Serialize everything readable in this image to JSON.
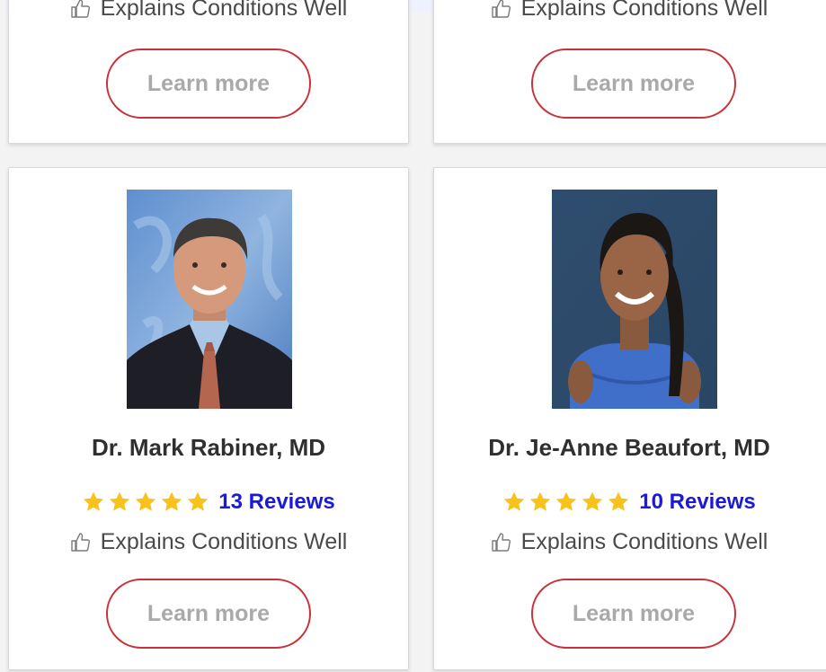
{
  "colors": {
    "star": "#f7c21b",
    "review_link": "#1a1ad8",
    "button_border": "#c8323a",
    "button_text": "#a9a9a9",
    "card_bg": "#ffffff",
    "page_bg": "#f3f3f3",
    "dark_strip": "#444444",
    "blue_strip": "#eef1ff"
  },
  "cards_top": [
    {
      "tagline": "Explains Conditions Well",
      "button": "Learn more"
    },
    {
      "tagline": "Explains Conditions Well",
      "button": "Learn more"
    }
  ],
  "cards": [
    {
      "name": "Dr. Mark Rabiner, MD",
      "rating": 5,
      "reviews": "13 Reviews",
      "tagline": "Explains Conditions Well",
      "button": "Learn more"
    },
    {
      "name": "Dr. Je-Anne Beaufort, MD",
      "rating": 5,
      "reviews": "10 Reviews",
      "tagline": "Explains Conditions Well",
      "button": "Learn more"
    }
  ]
}
